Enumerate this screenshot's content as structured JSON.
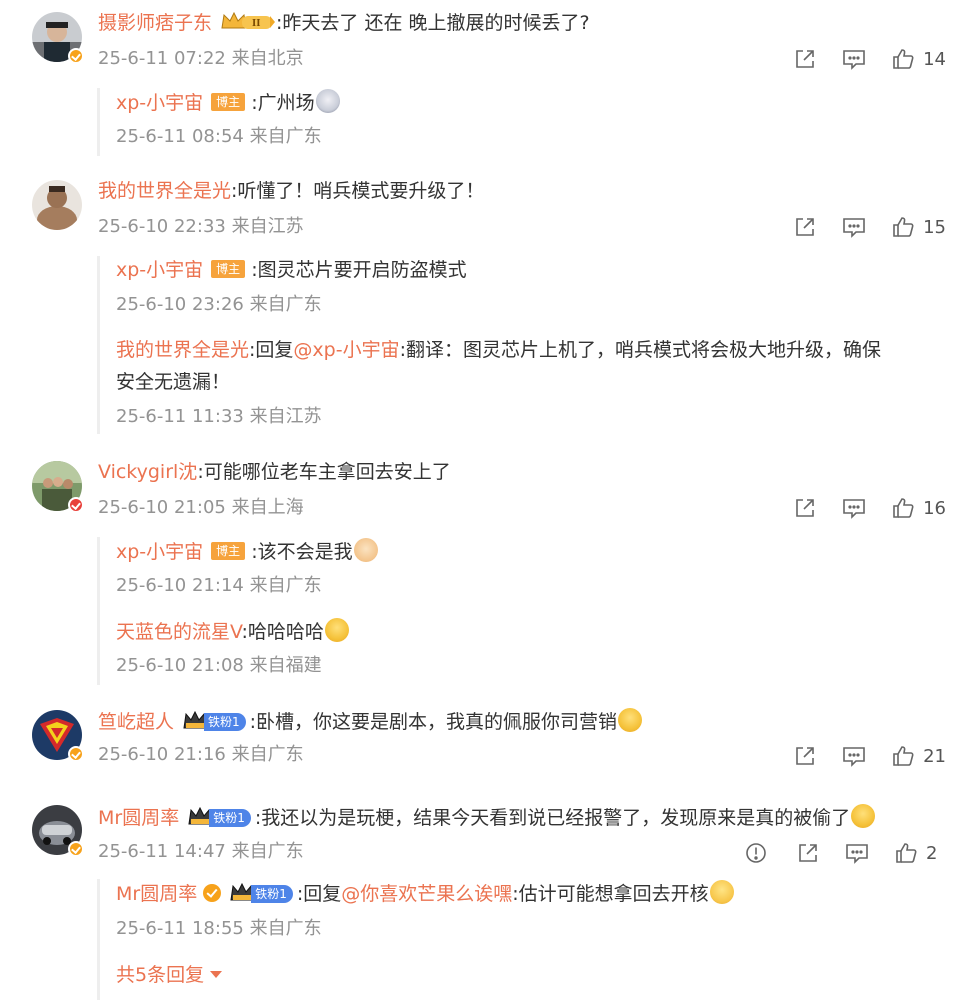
{
  "comments": [
    {
      "user": "摄影师痞子东",
      "text": ":昨天去了 还在 晚上撤展的时候丢了?",
      "meta": "25-6-11 07:22 来自北京",
      "likes": "14",
      "replies": [
        {
          "user": "xp-小宇宙",
          "tag": "博主",
          "text": ":广州场",
          "meta": "25-6-11 08:54 来自广东"
        }
      ]
    },
    {
      "user": "我的世界全是光",
      "text": ":听懂了！哨兵模式要升级了！",
      "meta": "25-6-10 22:33 来自江苏",
      "likes": "15",
      "replies": [
        {
          "user": "xp-小宇宙",
          "tag": "博主",
          "text": ":图灵芯片要开启防盗模式",
          "meta": "25-6-10 23:26 来自广东"
        },
        {
          "user": "我的世界全是光",
          "text_prefix": ":回复",
          "mention": "@xp-小宇宙",
          "text": ":翻译：图灵芯片上机了，哨兵模式将会极大地升级，确保",
          "text2": "安全无遗漏！",
          "meta": "25-6-11 11:33 来自江苏"
        }
      ]
    },
    {
      "user": "Vickygirl沈",
      "text": ":可能哪位老车主拿回去安上了",
      "meta": "25-6-10 21:05 来自上海",
      "likes": "16",
      "replies": [
        {
          "user": "xp-小宇宙",
          "tag": "博主",
          "text": ":该不会是我",
          "meta": "25-6-10 21:14 来自广东"
        },
        {
          "user": "天蓝色的流星V",
          "text": ":哈哈哈哈",
          "meta": "25-6-10 21:08 来自福建"
        }
      ]
    },
    {
      "user": "笪屹超人",
      "badge": "铁粉1",
      "text": ":卧槽，你这要是剧本，我真的佩服你司营销",
      "meta": "25-6-10 21:16 来自广东",
      "likes": "21"
    },
    {
      "user": "Mr圆周率",
      "badge": "铁粉1",
      "text": ":我还以为是玩梗，结果今天看到说已经报警了，发现原来是真的被偷了",
      "meta": "25-6-11 14:47 来自广东",
      "likes": "2",
      "replies": [
        {
          "user": "Mr圆周率",
          "badge": "铁粉1",
          "text_prefix": ":回复",
          "mention": "@你喜欢芒果么诶嘿",
          "text": ":估计可能想拿回去开核",
          "meta": "25-6-11 18:55 来自广东"
        }
      ],
      "more_replies": "共5条回复"
    }
  ],
  "colors": {
    "username": "#eb7350",
    "meta": "#939393",
    "blogger_tag": "#f6a33c",
    "fan_badge": "#4e84e8"
  },
  "icons": [
    "share-icon",
    "comment-icon",
    "like-icon",
    "report-icon",
    "emoji-laugh-icon",
    "emoji-cat-icon",
    "emoji-husky-icon",
    "emoji-think-icon",
    "crown-icon",
    "verified-icon"
  ]
}
